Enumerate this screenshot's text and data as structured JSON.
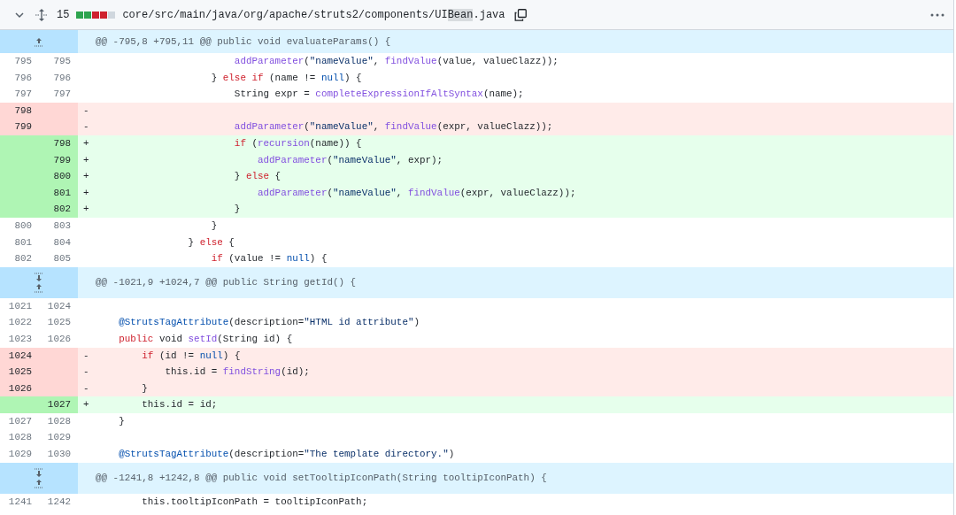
{
  "file_header": {
    "expanded": true,
    "changes": "15",
    "diffstat": [
      {
        "color": "#2da44e"
      },
      {
        "color": "#2da44e"
      },
      {
        "color": "#cf222e"
      },
      {
        "color": "#cf222e"
      },
      {
        "color": "#d0d7de"
      }
    ],
    "path": [
      {
        "text": "core/src/main/java/org/apache/struts2/components/UI",
        "highlighted": false
      },
      {
        "text": "Bean",
        "highlighted": true
      },
      {
        "text": ".java",
        "highlighted": false
      }
    ]
  },
  "rows": [
    {
      "kind": "hunk",
      "text": "@@ -795,8 +795,11 @@ public void evaluateParams() {"
    },
    {
      "kind": "context",
      "old": "795",
      "new": "795",
      "code": [
        {
          "kind": "func",
          "text": "                        addParameter"
        },
        {
          "kind": "plain",
          "text": "("
        },
        {
          "kind": "string",
          "text": "\"nameValue\""
        },
        {
          "kind": "plain",
          "text": ", "
        },
        {
          "kind": "func",
          "text": "findValue"
        },
        {
          "kind": "plain",
          "text": "(value, valueClazz));"
        }
      ]
    },
    {
      "kind": "context",
      "old": "796",
      "new": "796",
      "code": [
        {
          "kind": "plain",
          "text": "                    } "
        },
        {
          "kind": "keyword",
          "text": "else if"
        },
        {
          "kind": "plain",
          "text": " (name != "
        },
        {
          "kind": "const",
          "text": "null"
        },
        {
          "kind": "plain",
          "text": ") {"
        }
      ]
    },
    {
      "kind": "context",
      "old": "797",
      "new": "797",
      "code": [
        {
          "kind": "plain",
          "text": "                        String expr = "
        },
        {
          "kind": "func",
          "text": "completeExpressionIfAltSyntax"
        },
        {
          "kind": "plain",
          "text": "(name);"
        }
      ]
    },
    {
      "kind": "del",
      "old": "798",
      "sign": "-",
      "code": []
    },
    {
      "kind": "del",
      "old": "799",
      "sign": "-",
      "code": [
        {
          "kind": "func",
          "text": "                        addParameter"
        },
        {
          "kind": "plain",
          "text": "("
        },
        {
          "kind": "string",
          "text": "\"nameValue\""
        },
        {
          "kind": "plain",
          "text": ", "
        },
        {
          "kind": "func",
          "text": "findValue"
        },
        {
          "kind": "plain",
          "text": "(expr, valueClazz));"
        }
      ]
    },
    {
      "kind": "add",
      "new": "798",
      "sign": "+",
      "code": [
        {
          "kind": "keyword",
          "text": "                        if"
        },
        {
          "kind": "plain",
          "text": " ("
        },
        {
          "kind": "func",
          "text": "recursion"
        },
        {
          "kind": "plain",
          "text": "(name)) {"
        }
      ]
    },
    {
      "kind": "add",
      "new": "799",
      "sign": "+",
      "code": [
        {
          "kind": "func",
          "text": "                            addParameter"
        },
        {
          "kind": "plain",
          "text": "("
        },
        {
          "kind": "string",
          "text": "\"nameValue\""
        },
        {
          "kind": "plain",
          "text": ", expr);"
        }
      ]
    },
    {
      "kind": "add",
      "new": "800",
      "sign": "+",
      "code": [
        {
          "kind": "plain",
          "text": "                        } "
        },
        {
          "kind": "keyword",
          "text": "else"
        },
        {
          "kind": "plain",
          "text": " {"
        }
      ]
    },
    {
      "kind": "add",
      "new": "801",
      "sign": "+",
      "code": [
        {
          "kind": "func",
          "text": "                            addParameter"
        },
        {
          "kind": "plain",
          "text": "("
        },
        {
          "kind": "string",
          "text": "\"nameValue\""
        },
        {
          "kind": "plain",
          "text": ", "
        },
        {
          "kind": "func",
          "text": "findValue"
        },
        {
          "kind": "plain",
          "text": "(expr, valueClazz));"
        }
      ]
    },
    {
      "kind": "add",
      "new": "802",
      "sign": "+",
      "code": [
        {
          "kind": "plain",
          "text": "                        }"
        }
      ]
    },
    {
      "kind": "context",
      "old": "800",
      "new": "803",
      "code": [
        {
          "kind": "plain",
          "text": "                    }"
        }
      ]
    },
    {
      "kind": "context",
      "old": "801",
      "new": "804",
      "code": [
        {
          "kind": "plain",
          "text": "                } "
        },
        {
          "kind": "keyword",
          "text": "else"
        },
        {
          "kind": "plain",
          "text": " {"
        }
      ]
    },
    {
      "kind": "context",
      "old": "802",
      "new": "805",
      "code": [
        {
          "kind": "keyword",
          "text": "                    if"
        },
        {
          "kind": "plain",
          "text": " (value != "
        },
        {
          "kind": "const",
          "text": "null"
        },
        {
          "kind": "plain",
          "text": ") {"
        }
      ]
    },
    {
      "kind": "gap",
      "text": "@@ -1021,9 +1024,7 @@ public String getId() {"
    },
    {
      "kind": "context",
      "old": "1021",
      "new": "1024",
      "code": []
    },
    {
      "kind": "context",
      "old": "1022",
      "new": "1025",
      "code": [
        {
          "kind": "const",
          "text": "    @StrutsTagAttribute"
        },
        {
          "kind": "plain",
          "text": "(description="
        },
        {
          "kind": "string",
          "text": "\"HTML id attribute\""
        },
        {
          "kind": "plain",
          "text": ")"
        }
      ]
    },
    {
      "kind": "context",
      "old": "1023",
      "new": "1026",
      "code": [
        {
          "kind": "keyword",
          "text": "    public"
        },
        {
          "kind": "plain",
          "text": " void "
        },
        {
          "kind": "func",
          "text": "setId"
        },
        {
          "kind": "plain",
          "text": "(String id) {"
        }
      ]
    },
    {
      "kind": "del",
      "old": "1024",
      "sign": "-",
      "code": [
        {
          "kind": "keyword",
          "text": "        if"
        },
        {
          "kind": "plain",
          "text": " (id != "
        },
        {
          "kind": "const",
          "text": "null"
        },
        {
          "kind": "plain",
          "text": ") {"
        }
      ]
    },
    {
      "kind": "del",
      "old": "1025",
      "sign": "-",
      "code": [
        {
          "kind": "plain",
          "text": "            this.id = "
        },
        {
          "kind": "func",
          "text": "findString"
        },
        {
          "kind": "plain",
          "text": "(id);"
        }
      ]
    },
    {
      "kind": "del",
      "old": "1026",
      "sign": "-",
      "code": [
        {
          "kind": "plain",
          "text": "        }"
        }
      ]
    },
    {
      "kind": "add",
      "new": "1027",
      "sign": "+",
      "code": [
        {
          "kind": "plain",
          "text": "        this.id = id;"
        }
      ]
    },
    {
      "kind": "context",
      "old": "1027",
      "new": "1028",
      "code": [
        {
          "kind": "plain",
          "text": "    }"
        }
      ]
    },
    {
      "kind": "context",
      "old": "1028",
      "new": "1029",
      "code": []
    },
    {
      "kind": "context",
      "old": "1029",
      "new": "1030",
      "code": [
        {
          "kind": "const",
          "text": "    @StrutsTagAttribute"
        },
        {
          "kind": "plain",
          "text": "(description="
        },
        {
          "kind": "string",
          "text": "\"The template directory.\""
        },
        {
          "kind": "plain",
          "text": ")"
        }
      ]
    },
    {
      "kind": "gap",
      "text": "@@ -1241,8 +1242,8 @@ public void setTooltipIconPath(String tooltipIconPath) {"
    },
    {
      "kind": "context",
      "old": "1241",
      "new": "1242",
      "code": [
        {
          "kind": "plain",
          "text": "        this.tooltipIconPath = tooltipIconPath;"
        }
      ]
    }
  ]
}
